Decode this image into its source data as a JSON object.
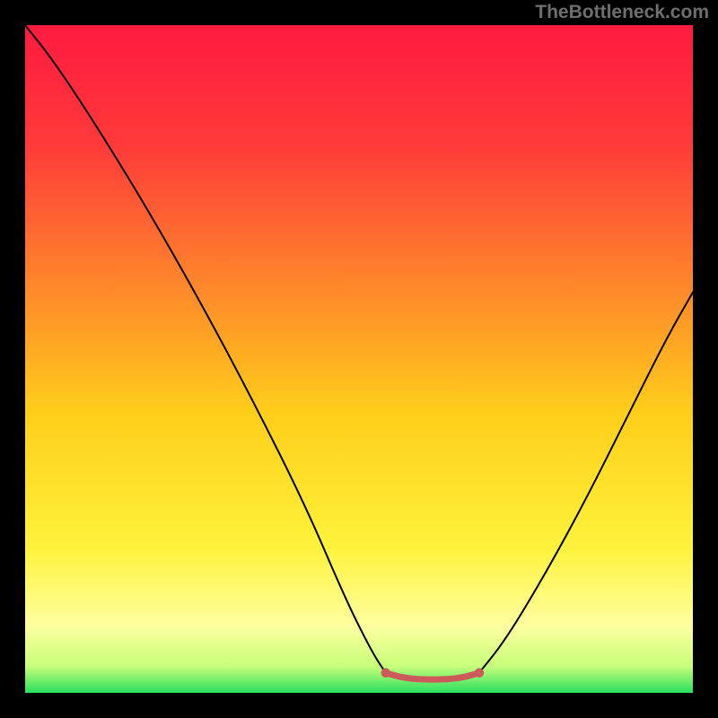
{
  "watermark": "TheBottleneck.com",
  "chart_data": {
    "type": "line",
    "title": "",
    "xlabel": "",
    "ylabel": "",
    "xlim": [
      0,
      100
    ],
    "ylim": [
      0,
      100
    ],
    "grid": false,
    "legend": false,
    "background_gradient": {
      "stops": [
        {
          "offset": 0.0,
          "color": "#ff1a40"
        },
        {
          "offset": 0.18,
          "color": "#ff3a3a"
        },
        {
          "offset": 0.4,
          "color": "#ff8a2a"
        },
        {
          "offset": 0.58,
          "color": "#ffce1a"
        },
        {
          "offset": 0.78,
          "color": "#fff23a"
        },
        {
          "offset": 0.9,
          "color": "#ffffa0"
        },
        {
          "offset": 0.96,
          "color": "#c8ff7a"
        },
        {
          "offset": 1.0,
          "color": "#28e060"
        }
      ]
    },
    "series": [
      {
        "name": "curve-left",
        "color": "#000000",
        "width": 2,
        "points": [
          {
            "x": 0,
            "y": 100
          },
          {
            "x": 4,
            "y": 95
          },
          {
            "x": 10,
            "y": 86
          },
          {
            "x": 18,
            "y": 73
          },
          {
            "x": 26,
            "y": 59
          },
          {
            "x": 34,
            "y": 44
          },
          {
            "x": 42,
            "y": 28
          },
          {
            "x": 48,
            "y": 14
          },
          {
            "x": 52,
            "y": 6
          },
          {
            "x": 54,
            "y": 3
          }
        ]
      },
      {
        "name": "curve-right",
        "color": "#000000",
        "width": 2,
        "points": [
          {
            "x": 68,
            "y": 3
          },
          {
            "x": 72,
            "y": 8
          },
          {
            "x": 78,
            "y": 18
          },
          {
            "x": 84,
            "y": 29
          },
          {
            "x": 90,
            "y": 41
          },
          {
            "x": 96,
            "y": 53
          },
          {
            "x": 100,
            "y": 60
          }
        ]
      },
      {
        "name": "valley-marker",
        "color": "#cc5a5a",
        "width": 7,
        "points": [
          {
            "x": 54,
            "y": 3.0
          },
          {
            "x": 56,
            "y": 2.4
          },
          {
            "x": 58,
            "y": 2.1
          },
          {
            "x": 60,
            "y": 2.0
          },
          {
            "x": 62,
            "y": 2.0
          },
          {
            "x": 64,
            "y": 2.1
          },
          {
            "x": 66,
            "y": 2.4
          },
          {
            "x": 68,
            "y": 3.0
          }
        ]
      }
    ]
  }
}
